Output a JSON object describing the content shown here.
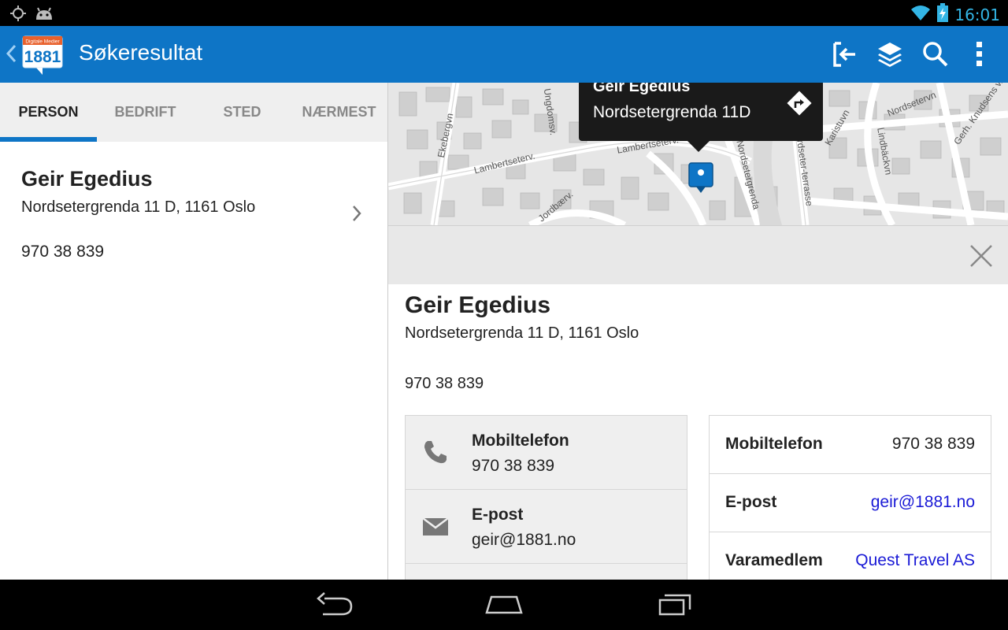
{
  "status_bar": {
    "time": "16:01",
    "icons": [
      "gps-icon",
      "android-icon",
      "wifi-icon",
      "battery-charging-icon"
    ]
  },
  "action_bar": {
    "title": "Søkeresultat",
    "logo_top_text": "Digitale Medier",
    "logo_number": "1881",
    "actions": [
      "logout-icon",
      "layers-icon",
      "search-icon",
      "overflow-menu-icon"
    ]
  },
  "tabs": [
    {
      "label": "PERSON",
      "active": true
    },
    {
      "label": "BEDRIFT",
      "active": false
    },
    {
      "label": "STED",
      "active": false
    },
    {
      "label": "NÆRMEST",
      "active": false
    }
  ],
  "result": {
    "name": "Geir Egedius",
    "address": "Nordsetergrenda 11 D, 1161 Oslo",
    "phone": "970 38 839"
  },
  "map": {
    "callout_name": "Geir Egedius",
    "callout_address": "Nordsetergrenda 11D",
    "streets": [
      "Ekebergvn",
      "Lambertseterv.",
      "Lambertseterv.",
      "Nordsetergrenda",
      "Nordseter-terrasse",
      "Karistuvn",
      "Lindbäckvn",
      "Gerh. Knudsens v.",
      "Jordbærv.",
      "Ungdomsv.",
      "Nordsetervn"
    ]
  },
  "detail": {
    "name": "Geir Egedius",
    "address": "Nordsetergrenda 11 D, 1161 Oslo",
    "phone": "970 38 839",
    "contact_card": [
      {
        "label": "Mobiltelefon",
        "value": "970 38 839",
        "icon": "phone-icon"
      },
      {
        "label": "E-post",
        "value": "geir@1881.no",
        "icon": "mail-icon"
      }
    ],
    "info_card": [
      {
        "label": "Mobiltelefon",
        "value": "970 38 839"
      },
      {
        "label": "E-post",
        "value": "geir@1881.no"
      },
      {
        "label": "Varamedlem",
        "value": "Quest Travel AS"
      }
    ]
  },
  "nav_bar": [
    "back-icon",
    "home-icon",
    "recent-apps-icon"
  ],
  "colors": {
    "accent": "#0e75c6",
    "link": "#1a1ad6",
    "clock": "#33b5e5"
  }
}
